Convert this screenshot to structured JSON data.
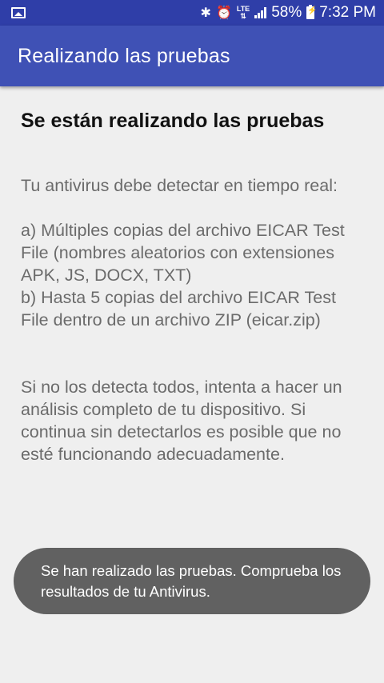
{
  "status_bar": {
    "battery": "58%",
    "time": "7:32 PM",
    "lte": "LTE",
    "icons": [
      "gallery-icon",
      "bluetooth-icon",
      "alarm-icon",
      "lte-icon",
      "signal-icon",
      "battery-icon"
    ]
  },
  "app_bar": {
    "title": "Realizando las pruebas"
  },
  "main": {
    "heading": "Se están realizando las pruebas",
    "para1": "Tu antivirus debe detectar en tiempo real:",
    "para2": " a) Múltiples copias del archivo EICAR Test File (nombres aleatorios con extensiones APK, JS, DOCX, TXT)\n b) Hasta 5 copias del archivo EICAR Test File dentro de un archivo ZIP (eicar.zip)",
    "para3": " Si no los detecta todos, intenta a hacer un análisis completo de tu dispositivo. Si continua sin detectarlos es posible que no esté funcionando adecuadamente."
  },
  "toast": {
    "message": "Se han realizado las pruebas. Comprueba los resultados de tu Antivirus."
  },
  "colors": {
    "status_bar": "#2f3ea8",
    "app_bar": "#3f51b5",
    "background": "#efefef",
    "toast": "#616161"
  }
}
